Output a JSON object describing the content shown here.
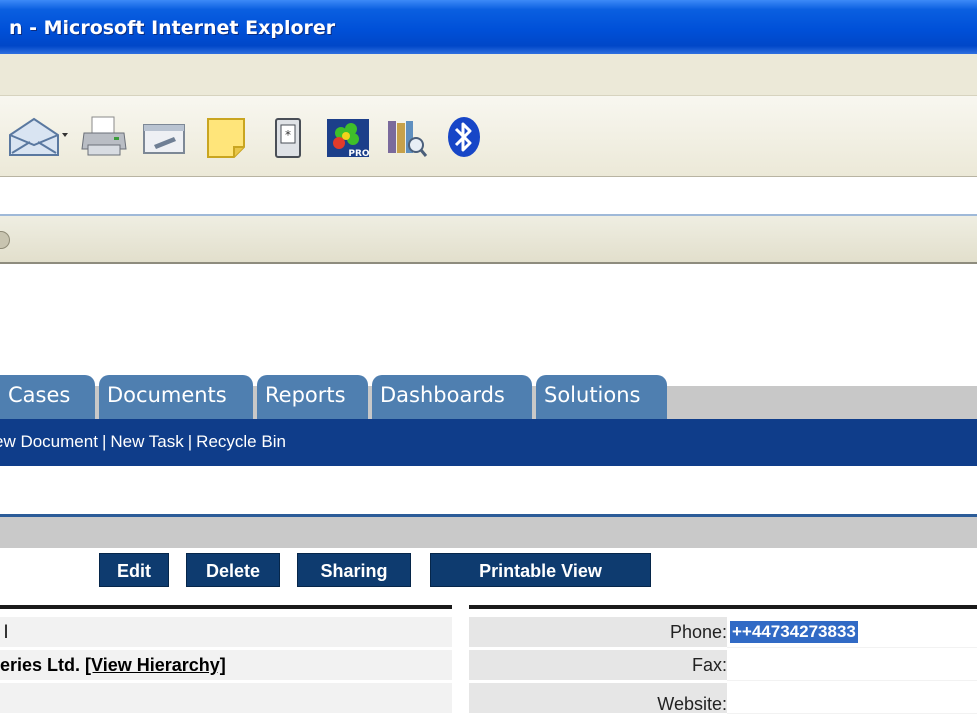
{
  "window": {
    "title": "n - Microsoft Internet Explorer"
  },
  "toolbar": {
    "icons": [
      "mail-icon",
      "print-icon",
      "edit-icon",
      "note-icon",
      "phone-device-icon",
      "icq-pro-icon",
      "research-icon",
      "bluetooth-icon"
    ]
  },
  "tabs": [
    {
      "label": "Cases"
    },
    {
      "label": "Documents"
    },
    {
      "label": "Reports"
    },
    {
      "label": "Dashboards"
    },
    {
      "label": "Solutions"
    }
  ],
  "subnav": {
    "new_document": "ew Document",
    "separator": "|",
    "new_task": "New Task",
    "recycle_bin": "Recycle Bin"
  },
  "buttons": {
    "edit": "Edit",
    "delete": "Delete",
    "sharing": "Sharing",
    "printable_view": "Printable View"
  },
  "left_panel": {
    "row1": "l",
    "row2_account": "eries Ltd.",
    "row2_link": "[View Hierarchy]"
  },
  "right_panel": {
    "phone_label": "Phone:",
    "phone_value": "++44734273833",
    "fax_label": "Fax:",
    "website_label": "Website:"
  },
  "colors": {
    "title_bar": "#0050d8",
    "tab": "#4f7fb0",
    "subnav": "#0f3d8a",
    "button": "#0e3b6f",
    "selection": "#316ac5"
  }
}
